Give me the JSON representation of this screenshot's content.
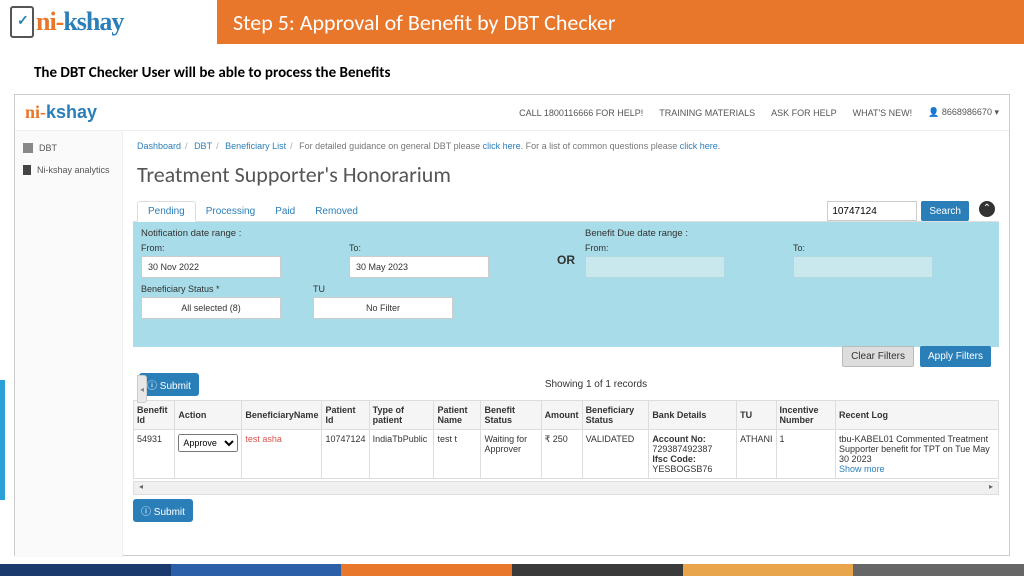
{
  "header": {
    "logo_ni": "ni-",
    "logo_kshay": "kshay",
    "step_title": "Step 5: Approval of  Benefit by DBT Checker",
    "subtitle": "The DBT Checker User will be able to process the Benefits"
  },
  "top_nav": {
    "help_call": "CALL 1800116666 FOR HELP!",
    "training": "TRAINING MATERIALS",
    "ask_help": "ASK FOR HELP",
    "whats_new": "WHAT'S NEW!",
    "user": "8668986670",
    "user_caret": "▾"
  },
  "sidebar": {
    "items": [
      {
        "label": "DBT"
      },
      {
        "label": "Ni-kshay analytics"
      }
    ]
  },
  "breadcrumb": {
    "dashboard": "Dashboard",
    "dbt": "DBT",
    "beneficiary": "Beneficiary List",
    "tail1": "For detailed guidance on general DBT please ",
    "click1": "click here",
    "tail2": ". For a list of common questions please ",
    "click2": "click here",
    "tail3": "."
  },
  "page": {
    "title": "Treatment Supporter's Honorarium"
  },
  "tabs": [
    {
      "label": "Pending",
      "active": true
    },
    {
      "label": "Processing"
    },
    {
      "label": "Paid"
    },
    {
      "label": "Removed"
    }
  ],
  "search": {
    "value": "10747124",
    "btn": "Search"
  },
  "filters": {
    "notif_label": "Notification date range :",
    "from_label": "From:",
    "from_val": "30 Nov 2022",
    "to_label": "To:",
    "to_val": "30 May 2023",
    "or": "OR",
    "due_label": "Benefit Due date range :",
    "due_from_label": "From:",
    "due_to_label": "To:",
    "ben_status_label": "Beneficiary Status *",
    "ben_status_val": "All selected (8)",
    "tu_label": "TU",
    "tu_val": "No Filter",
    "clear_btn": "Clear Filters",
    "apply_btn": "Apply Filters"
  },
  "submit": {
    "label": "Submit"
  },
  "records": {
    "text": "Showing 1 of 1 records"
  },
  "chart_data": {
    "type": "table",
    "columns": [
      "Benefit Id",
      "Action",
      "BeneficiaryName",
      "Patient Id",
      "Type of patient",
      "Patient Name",
      "Benefit Status",
      "Amount",
      "Beneficiary Status",
      "Bank Details",
      "TU",
      "Incentive Number",
      "Recent Log"
    ],
    "rows": [
      {
        "benefit_id": "54931",
        "action": "Approve",
        "beneficiary_name": "test asha",
        "patient_id": "10747124",
        "type_of_patient": "IndiaTbPublic",
        "patient_name": "test t",
        "benefit_status": "Waiting for Approver",
        "amount": "₹ 250",
        "beneficiary_status": "VALIDATED",
        "bank_account_label": "Account No:",
        "bank_account": "729387492387",
        "bank_ifsc_label": "Ifsc Code:",
        "bank_ifsc": "YESBOGSB76",
        "tu": "ATHANI",
        "incentive_number": "1",
        "recent_log": "tbu-KABEL01 Commented Treatment Supporter benefit for TPT on Tue May 30 2023",
        "show_more": "Show more"
      }
    ]
  }
}
